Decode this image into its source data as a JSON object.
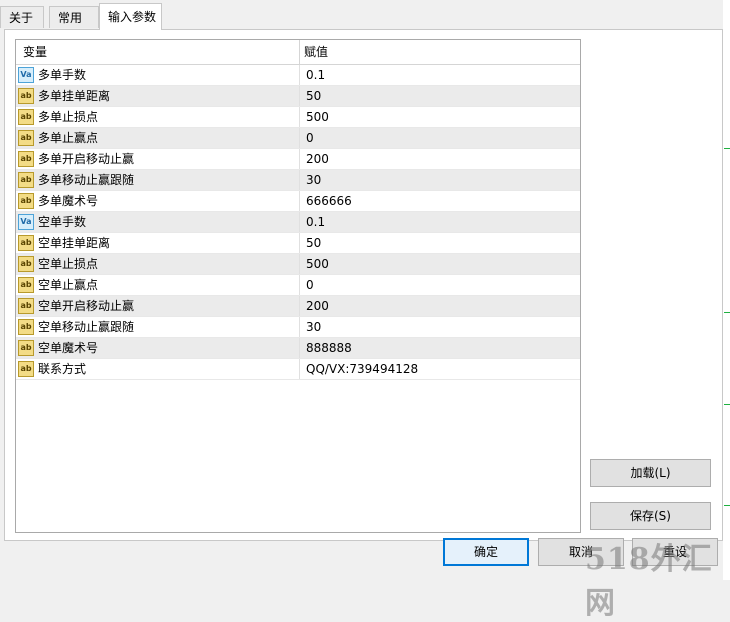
{
  "tabs": [
    {
      "label": "关于",
      "active": false
    },
    {
      "label": "常用",
      "active": false
    },
    {
      "label": "输入参数",
      "active": true
    }
  ],
  "grid": {
    "headers": {
      "variable": "变量",
      "value": "赋值"
    },
    "rows": [
      {
        "icon": "double",
        "name": "多单手数",
        "value": "0.1"
      },
      {
        "icon": "ab",
        "name": "多单挂单距离",
        "value": "50"
      },
      {
        "icon": "ab",
        "name": "多单止损点",
        "value": "500"
      },
      {
        "icon": "ab",
        "name": "多单止赢点",
        "value": "0"
      },
      {
        "icon": "ab",
        "name": "多单开启移动止赢",
        "value": "200"
      },
      {
        "icon": "ab",
        "name": "多单移动止赢跟随",
        "value": "30"
      },
      {
        "icon": "ab",
        "name": "多单魔术号",
        "value": "666666"
      },
      {
        "icon": "double",
        "name": "空单手数",
        "value": "0.1"
      },
      {
        "icon": "ab",
        "name": "空单挂单距离",
        "value": "50"
      },
      {
        "icon": "ab",
        "name": "空单止损点",
        "value": "500"
      },
      {
        "icon": "ab",
        "name": "空单止赢点",
        "value": "0"
      },
      {
        "icon": "ab",
        "name": "空单开启移动止赢",
        "value": "200"
      },
      {
        "icon": "ab",
        "name": "空单移动止赢跟随",
        "value": "30"
      },
      {
        "icon": "ab",
        "name": "空单魔术号",
        "value": "888888"
      },
      {
        "icon": "ab",
        "name": "联系方式",
        "value": "QQ/VX:739494128"
      }
    ]
  },
  "icons": {
    "ab": "ab",
    "double": "Va"
  },
  "buttons": {
    "load": "加载(L)",
    "save": "保存(S)",
    "ok": "确定",
    "cancel": "取消",
    "reset": "重设"
  },
  "watermark": "518外汇网",
  "colors": {
    "accent": "#0078d7",
    "row_alt": "#ebebeb",
    "chart_green": "#1fb141"
  }
}
